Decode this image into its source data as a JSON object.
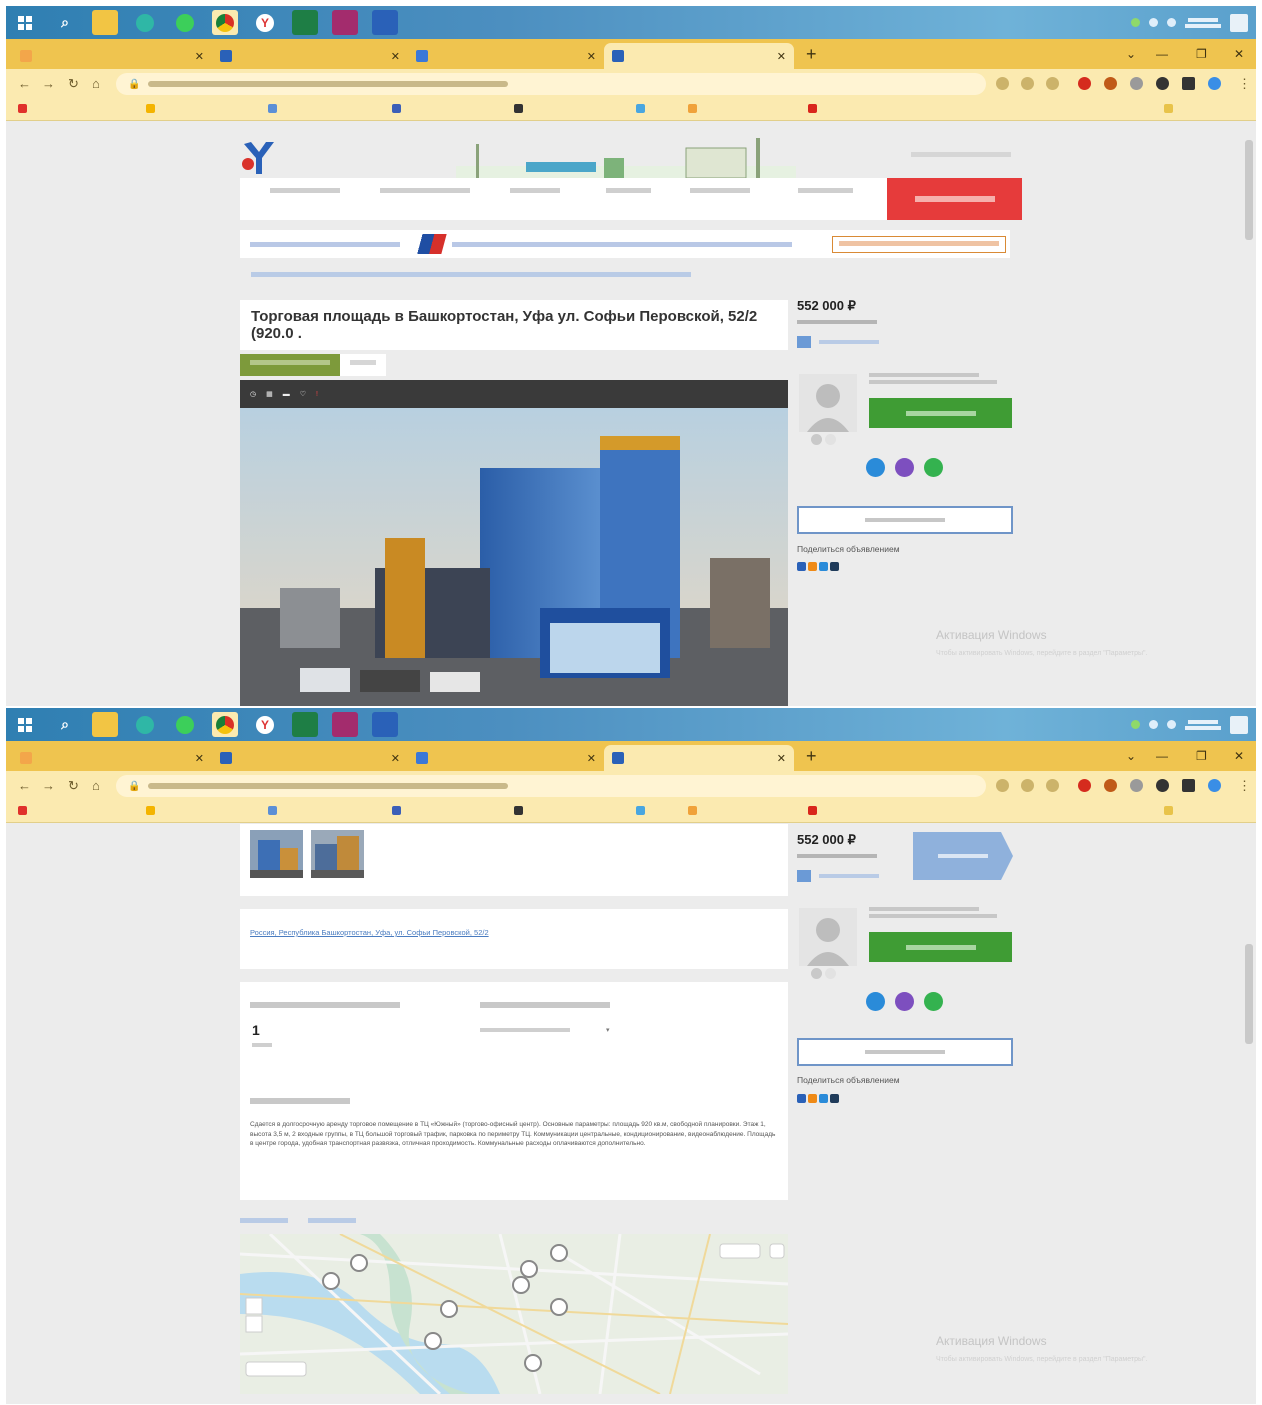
{
  "listing": {
    "title": "Торговая площадь в Башкортостан, Уфа ул. Софьи Перовской, 52/2 (920.0 .",
    "price": "552 000 ₽",
    "address": "Россия, Республика Башкортостан, Уфа, ул. Софьи Перовской, 52/2",
    "floor_value": "1",
    "description": "Сдается в долгосрочную аренду торговое помещение в ТЦ «Южный» (торгово-офисный центр). Основные параметры: площадь 920 кв.м, свободной планировки. Этаж 1, высота 3,5 м, 2 входные группы, в ТЦ большой торговый трафик, парковка по периметру ТЦ. Коммуникации центральные, кондиционирование, видеонаблюдение. Площадь в центре города, удобная транспортная развязка, отличная проходимость. Коммунальные расходы оплачиваются дополнительно."
  },
  "sidebar": {
    "share_label": "Поделиться объявлением"
  },
  "watermark": {
    "title": "Активация Windows",
    "text": "Чтобы активировать Windows, перейдите в раздел \"Параметры\"."
  },
  "colors": {
    "taskbar": "#3d87bb",
    "chrome_tabs": "#efc44f",
    "add_button": "#e63b3b",
    "call_button": "#3f9c34",
    "link": "#4a7cc0"
  }
}
